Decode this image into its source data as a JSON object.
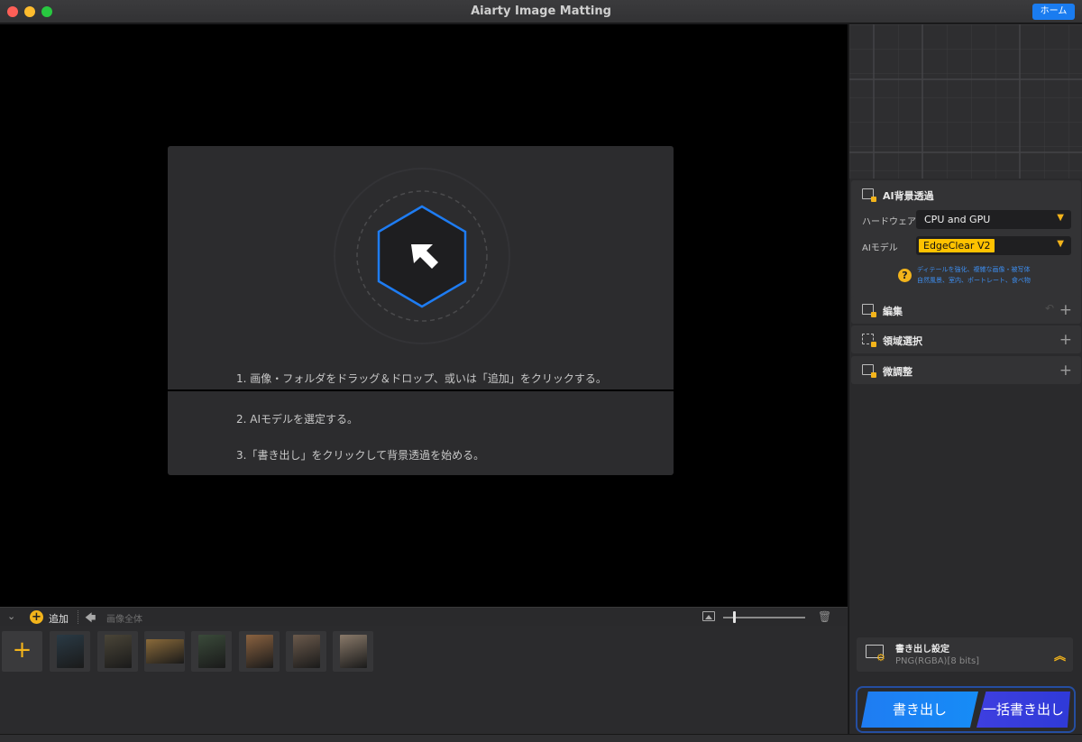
{
  "window": {
    "title": "Aiarty Image Matting",
    "home_button": "ホーム"
  },
  "drop_area": {
    "steps": [
      "1.  画像・フォルダをドラッグ＆ドロップ、或いは「追加」をクリックする。",
      "2.  AIモデルを選定する。",
      "3.「書き出し」をクリックして背景透過を始める。"
    ],
    "accent_color": "#1e7cf2"
  },
  "filmstrip": {
    "add_label": "追加",
    "whole_image_label": "画像全体",
    "zoom_level": 0.12,
    "thumbnails": [
      {
        "icon": "jellyfish-image",
        "color": "#2a3a45"
      },
      {
        "icon": "forest-roots-image",
        "color": "#4a4538"
      },
      {
        "icon": "bicycle-image",
        "color": "#8a6a3a"
      },
      {
        "icon": "girl-in-forest-image",
        "color": "#3a4a3a"
      },
      {
        "icon": "woman-with-flowers-image",
        "color": "#8a6240"
      },
      {
        "icon": "woman-portrait-image",
        "color": "#6b5a4c"
      },
      {
        "icon": "woman-dark-hair-image",
        "color": "#8a7a6a"
      }
    ]
  },
  "right_panel": {
    "ai_section": {
      "title": "AI背景透過",
      "hardware_label": "ハードウェア",
      "hardware_value": "CPU and GPU",
      "model_label": "AIモデル",
      "model_value": "EdgeClear  V2",
      "help_lines": [
        "ディテールを強化、複雑な画像・被写体",
        "自然風景、室内、ポートレート、食べ物"
      ]
    },
    "sections": [
      {
        "title": "編集",
        "icon": "edit-icon"
      },
      {
        "title": "領域選択",
        "icon": "selection-icon"
      },
      {
        "title": "微調整",
        "icon": "fine-tune-icon"
      }
    ],
    "export_settings": {
      "title": "書き出し設定",
      "format": "PNG(RGBA)[8 bits]"
    },
    "export_button": "書き出し",
    "batch_export_button": "一括書き出し"
  }
}
